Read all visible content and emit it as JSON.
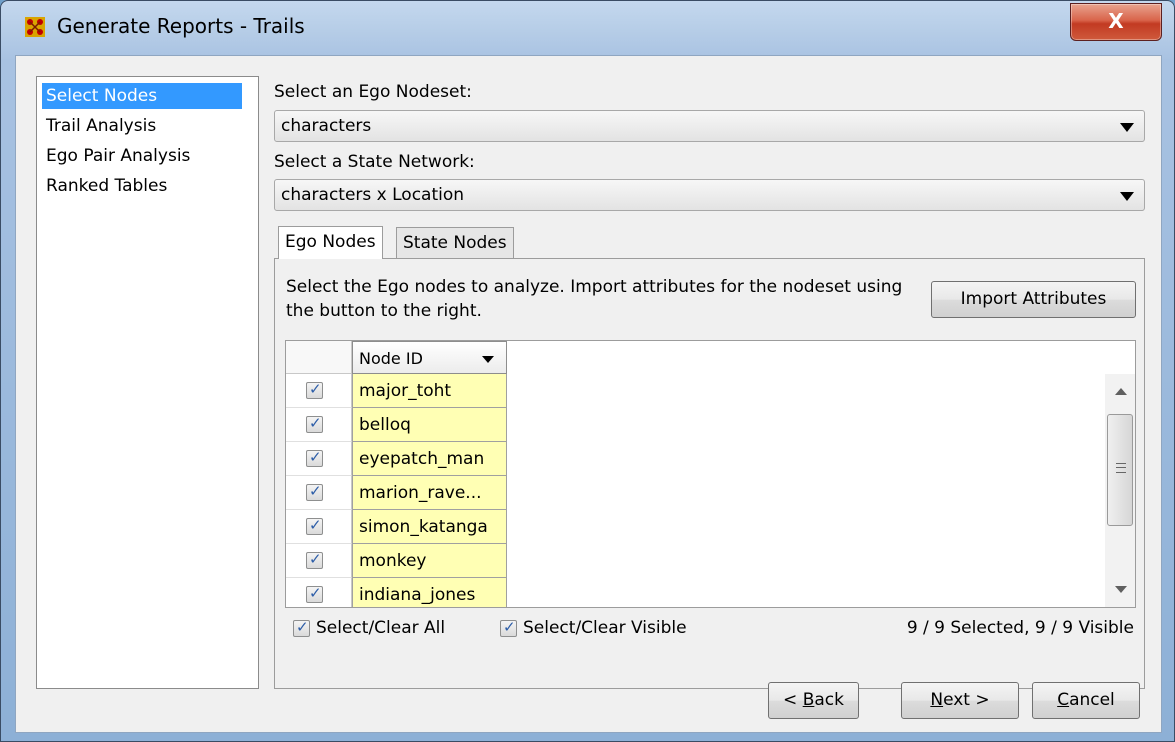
{
  "window": {
    "title": "Generate Reports - Trails",
    "close_label": "X"
  },
  "nav": {
    "items": [
      {
        "label": "Select Nodes",
        "selected": true
      },
      {
        "label": "Trail Analysis",
        "selected": false
      },
      {
        "label": "Ego Pair Analysis",
        "selected": false
      },
      {
        "label": "Ranked Tables",
        "selected": false
      }
    ]
  },
  "ego_nodeset": {
    "label": "Select an Ego Nodeset:",
    "value": "characters"
  },
  "state_network": {
    "label": "Select a State Network:",
    "value": "characters x Location"
  },
  "tabs": [
    {
      "label": "Ego Nodes",
      "active": true
    },
    {
      "label": "State Nodes",
      "active": false
    }
  ],
  "panel": {
    "description": "Select the Ego nodes to analyze. Import attributes for the nodeset using the button to the right.",
    "import_button": "Import Attributes",
    "table": {
      "column_header": "Node ID",
      "rows": [
        {
          "id": "major_toht",
          "checked": true
        },
        {
          "id": "belloq",
          "checked": true
        },
        {
          "id": "eyepatch_man",
          "checked": true
        },
        {
          "id": "marion_rave...",
          "checked": true
        },
        {
          "id": "simon_katanga",
          "checked": true
        },
        {
          "id": "monkey",
          "checked": true
        },
        {
          "id": "indiana_jones",
          "checked": true
        }
      ]
    },
    "select_clear_all": "Select/Clear All",
    "select_clear_visible": "Select/Clear Visible",
    "status": "9 / 9 Selected, 9 / 9 Visible"
  },
  "buttons": {
    "back": {
      "prefix": "< ",
      "mnemonic": "B",
      "rest": "ack"
    },
    "next": {
      "mnemonic": "N",
      "rest": "ext >"
    },
    "cancel": {
      "mnemonic": "C",
      "rest": "ancel"
    }
  },
  "colors": {
    "selection": "#3399ff",
    "node_cell": "#ffffb4",
    "close_button": "#c23a22"
  }
}
